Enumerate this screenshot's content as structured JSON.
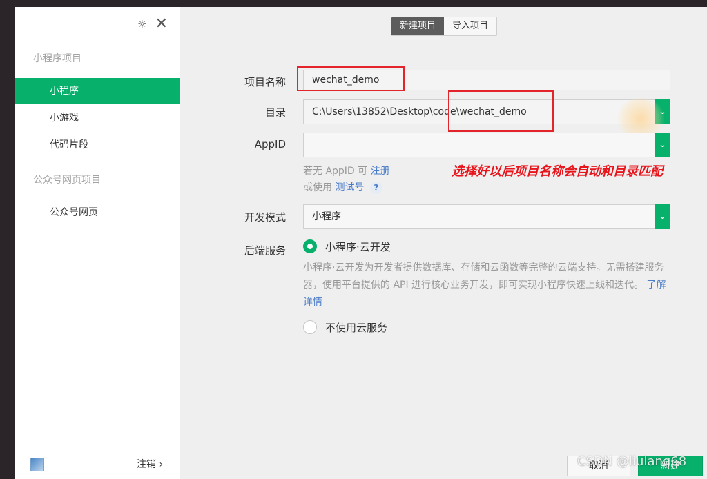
{
  "sidebar": {
    "section_mini": "小程序项目",
    "items": [
      {
        "label": "小程序"
      },
      {
        "label": "小游戏"
      },
      {
        "label": "代码片段"
      }
    ],
    "section_web": "公众号网页项目",
    "web_item": "公众号网页",
    "logout": "注销 ›"
  },
  "tabs": {
    "new_project": "新建项目",
    "import_project": "导入项目"
  },
  "form": {
    "name_label": "项目名称",
    "name_value": "wechat_demo",
    "dir_label": "目录",
    "dir_value": "C:\\Users\\13852\\Desktop\\code\\wechat_demo",
    "appid_label": "AppID",
    "appid_value": "",
    "hint_no_appid": "若无 AppID 可",
    "register_link": "注册",
    "hint_or_use": "或使用",
    "test_link": "测试号",
    "help": "?",
    "mode_label": "开发模式",
    "mode_value": "小程序",
    "backend_label": "后端服务",
    "option_cloud": "小程序·云开发",
    "cloud_desc": "小程序·云开发为开发者提供数据库、存储和云函数等完整的云端支持。无需搭建服务器，使用平台提供的 API 进行核心业务开发，即可实现小程序快速上线和迭代。",
    "learn_more": "了解详情",
    "option_no_cloud": "不使用云服务"
  },
  "annotation": "选择好以后项目名称会自动和目录匹配",
  "buttons": {
    "cancel": "取消",
    "create": "新建"
  },
  "watermark": "CSDN @liulang68",
  "colors": {
    "accent": "#07b06b",
    "annotation_red": "#e8141c"
  }
}
